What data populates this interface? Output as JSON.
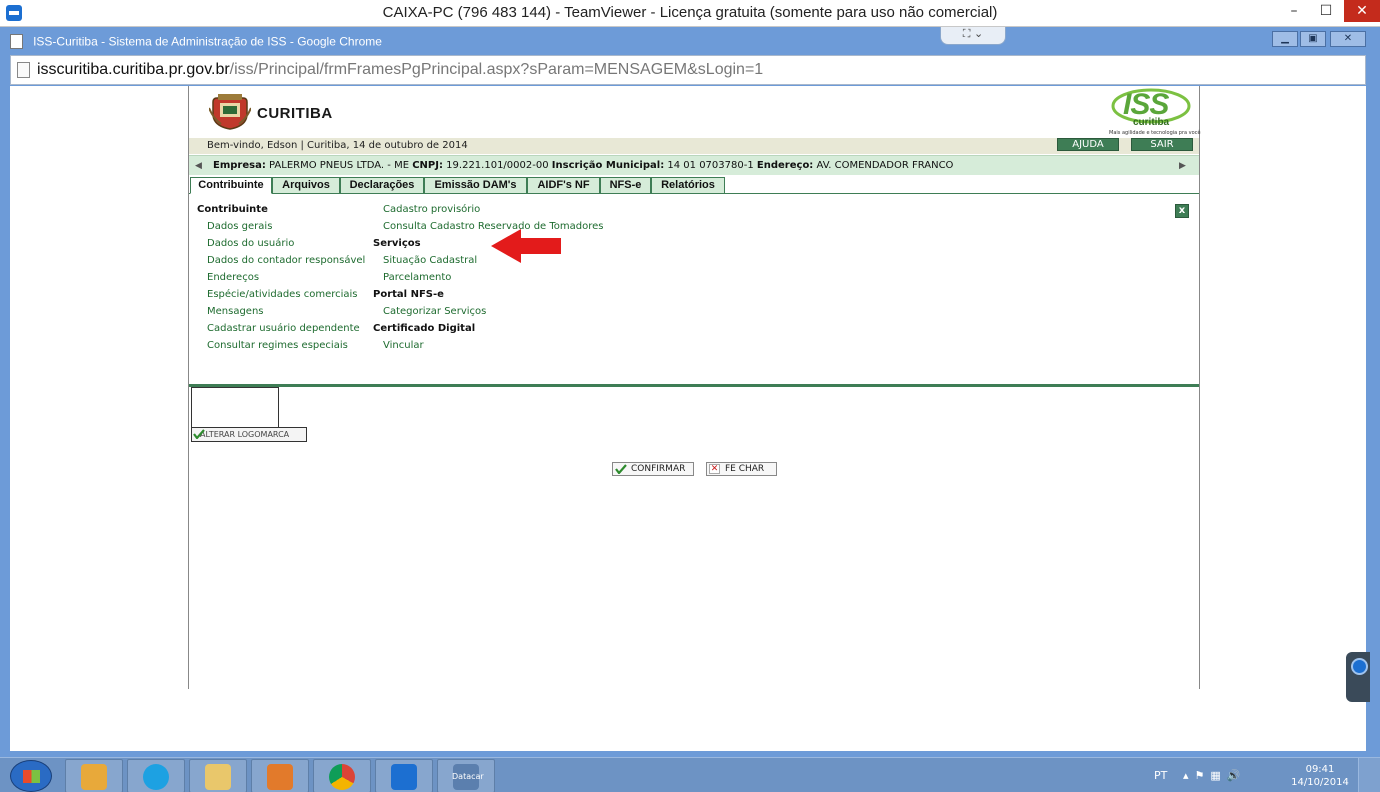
{
  "teamviewer": {
    "title": "CAIXA-PC (796 483 144) - TeamViewer - Licença gratuita (somente para uso não comercial)"
  },
  "chrome": {
    "window_title": "ISS-Curitiba - Sistema de Administração de ISS - Google Chrome",
    "url_host": "isscuritiba.curitiba.pr.gov.br",
    "url_path": "/iss/Principal/frmFramesPgPrincipal.aspx?sParam=MENSAGEM&sLogin=1"
  },
  "header": {
    "city_name": "CURITIBA",
    "iss_logo_text": "ISS",
    "iss_logo_sub": "curitiba",
    "iss_tagline": "Mais agilidade e tecnologia pra você",
    "welcome": "Bem-vindo, Edson | Curitiba, 14 de outubro de 2014",
    "ajuda_label": "AJUDA",
    "sair_label": "SAIR"
  },
  "empresa": {
    "empresa_label": "Empresa:",
    "empresa_value": "PALERMO PNEUS LTDA. - ME",
    "cnpj_label": "CNPJ:",
    "cnpj_value": "19.221.101/0002-00",
    "inscricao_label": "Inscrição Municipal:",
    "inscricao_value": "14 01 0703780-1",
    "endereco_label": "Endereço:",
    "endereco_value": "AV. COMENDADOR FRANCO"
  },
  "tabs": [
    {
      "label": "Contribuinte"
    },
    {
      "label": "Arquivos"
    },
    {
      "label": "Declarações"
    },
    {
      "label": "Emissão DAM's"
    },
    {
      "label": "AIDF's NF"
    },
    {
      "label": "NFS-e"
    },
    {
      "label": "Relatórios"
    }
  ],
  "menu": {
    "col1_heading": "Contribuinte",
    "col1_items": [
      "Dados gerais",
      "Dados do usuário",
      "Dados do contador responsável",
      "Endereços",
      "Espécie/atividades comerciais",
      "Mensagens",
      "Cadastrar usuário dependente",
      "Consultar regimes especiais"
    ],
    "col2": {
      "item_cadastro_provisorio": "Cadastro provisório",
      "item_consulta_cadastro": "Consulta Cadastro Reservado de Tomadores",
      "servicos_heading": "Serviços",
      "item_situacao": "Situação Cadastral",
      "item_parcelamento": "Parcelamento",
      "portal_heading": "Portal NFS-e",
      "item_categorizar": "Categorizar Serviços",
      "certificado_heading": "Certificado Digital",
      "item_vincular": "Vincular"
    },
    "close_label": "x"
  },
  "actions": {
    "alterar_logomarca": "ALTERAR LOGOMARCA",
    "confirmar": "CONFIRMAR",
    "fechar": "FE CHAR"
  },
  "taskbar": {
    "app_label_datacar": "Datacar",
    "lang": "PT",
    "time": "09:41",
    "date": "14/10/2014"
  },
  "colors": {
    "accent_green": "#3e7d55",
    "link_green": "#1e6b2f",
    "annotation_red": "#e31b1b"
  }
}
